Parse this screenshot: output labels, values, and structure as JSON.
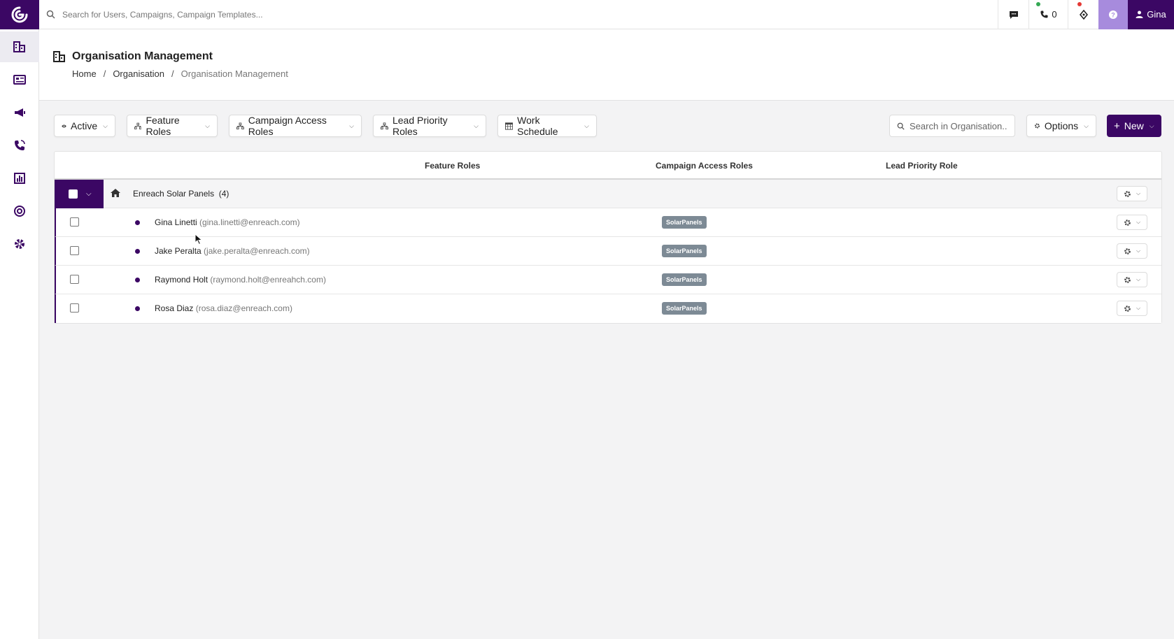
{
  "topbar": {
    "search_placeholder": "Search for Users, Campaigns, Campaign Templates...",
    "call_count": "0",
    "user_name": "Gina"
  },
  "sidebar": {
    "items": [
      {
        "icon": "organisation-icon",
        "active": true
      },
      {
        "icon": "contacts-icon",
        "active": false
      },
      {
        "icon": "megaphone-icon",
        "active": false
      },
      {
        "icon": "phone-icon",
        "active": false
      },
      {
        "icon": "chart-icon",
        "active": false
      },
      {
        "icon": "target-icon",
        "active": false
      },
      {
        "icon": "gear-icon",
        "active": false
      }
    ]
  },
  "header": {
    "title": "Organisation Management",
    "breadcrumb": [
      "Home",
      "Organisation",
      "Organisation Management"
    ]
  },
  "filters": {
    "active": "Active",
    "feature_roles": "Feature Roles",
    "campaign_access_roles": "Campaign Access Roles",
    "lead_priority_roles": "Lead Priority Roles",
    "work_schedule": "Work Schedule",
    "search_placeholder": "Search in Organisation...",
    "options": "Options",
    "new": "New"
  },
  "table": {
    "columns": {
      "feature_roles": "Feature Roles",
      "campaign_access_roles": "Campaign Access Roles",
      "lead_priority_role": "Lead Priority Role"
    },
    "group": {
      "name": "Enreach Solar Panels",
      "count": "(4)"
    },
    "rows": [
      {
        "name": "Gina Linetti",
        "email": "(gina.linetti@enreach.com)",
        "campaign_role": "SolarPanels"
      },
      {
        "name": "Jake Peralta",
        "email": "(jake.peralta@enreach.com)",
        "campaign_role": "SolarPanels"
      },
      {
        "name": "Raymond Holt",
        "email": "(raymond.holt@enreahch.com)",
        "campaign_role": "SolarPanels"
      },
      {
        "name": "Rosa Diaz",
        "email": "(rosa.diaz@enreach.com)",
        "campaign_role": "SolarPanels"
      }
    ]
  },
  "colors": {
    "brand": "#3b0764",
    "help": "#a78bdd",
    "badge": "#7d8a95"
  }
}
